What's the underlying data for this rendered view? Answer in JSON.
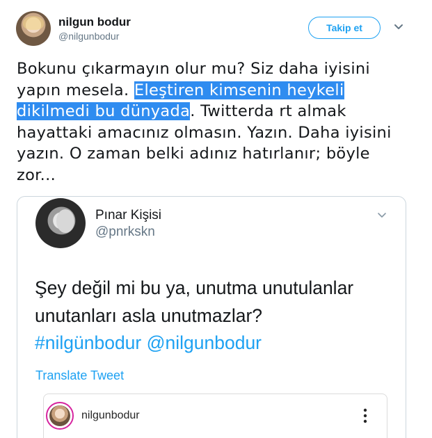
{
  "tweet": {
    "author": {
      "display_name": "nilgun bodur",
      "handle": "@nilgunbodur"
    },
    "follow_button_label": "Takip et",
    "menu_icon": "chevron-down-icon",
    "text": {
      "before_highlight": "Bokunu çıkarmayın olur mu? Siz daha iyisini yapın mesela. ",
      "highlight": "Eleştiren kimsenin heykeli dikilmedi bu dünyada",
      "after_highlight": ". Twitterda rt almak hayattaki amacınız olmasın. Yazın. Daha iyisini yazın. O zaman belki adınız hatırlanır; böyle zor..."
    },
    "highlight_color": "#2f8cf0"
  },
  "quoted_tweet": {
    "author": {
      "display_name": "Pınar Kişisi",
      "handle": "@pnrkskn"
    },
    "menu_icon": "chevron-down-icon",
    "text": "Şey değil mi bu ya, unutma unutulanlar unutanları asla unutmazlar?",
    "hashtags": "#nilgünbodur @nilgunbodur",
    "translate_label": "Translate Tweet",
    "instagram_embed": {
      "username": "nilgunbodur",
      "more_icon": "more-vertical-icon"
    }
  },
  "colors": {
    "link_blue": "#1da1f2",
    "muted_text": "#657786",
    "border": "#ccd6dd"
  }
}
